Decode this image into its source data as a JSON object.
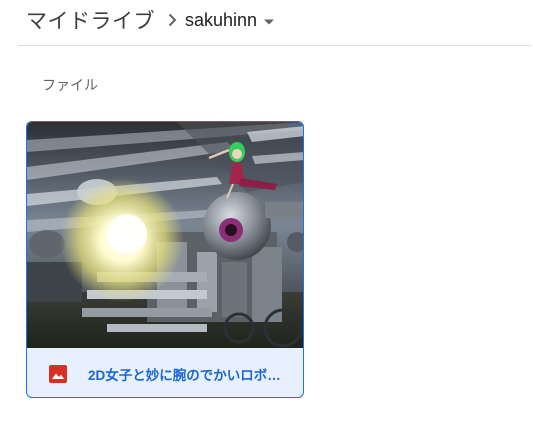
{
  "breadcrumb": {
    "root_label": "マイドライブ",
    "current_label": "sakuhinn"
  },
  "section": {
    "files_label": "ファイル"
  },
  "files": [
    {
      "name": "2D女子と妙に腕のでかいロボ…",
      "type_icon": "image-file-icon",
      "selected": true
    }
  ],
  "colors": {
    "accent": "#1a73e8",
    "selected_bg": "#e8f0fe",
    "file_name": "#1967d2",
    "image_icon": "#d93025",
    "text_primary": "#202124",
    "text_secondary": "#5f6368",
    "divider": "#dadce0"
  }
}
